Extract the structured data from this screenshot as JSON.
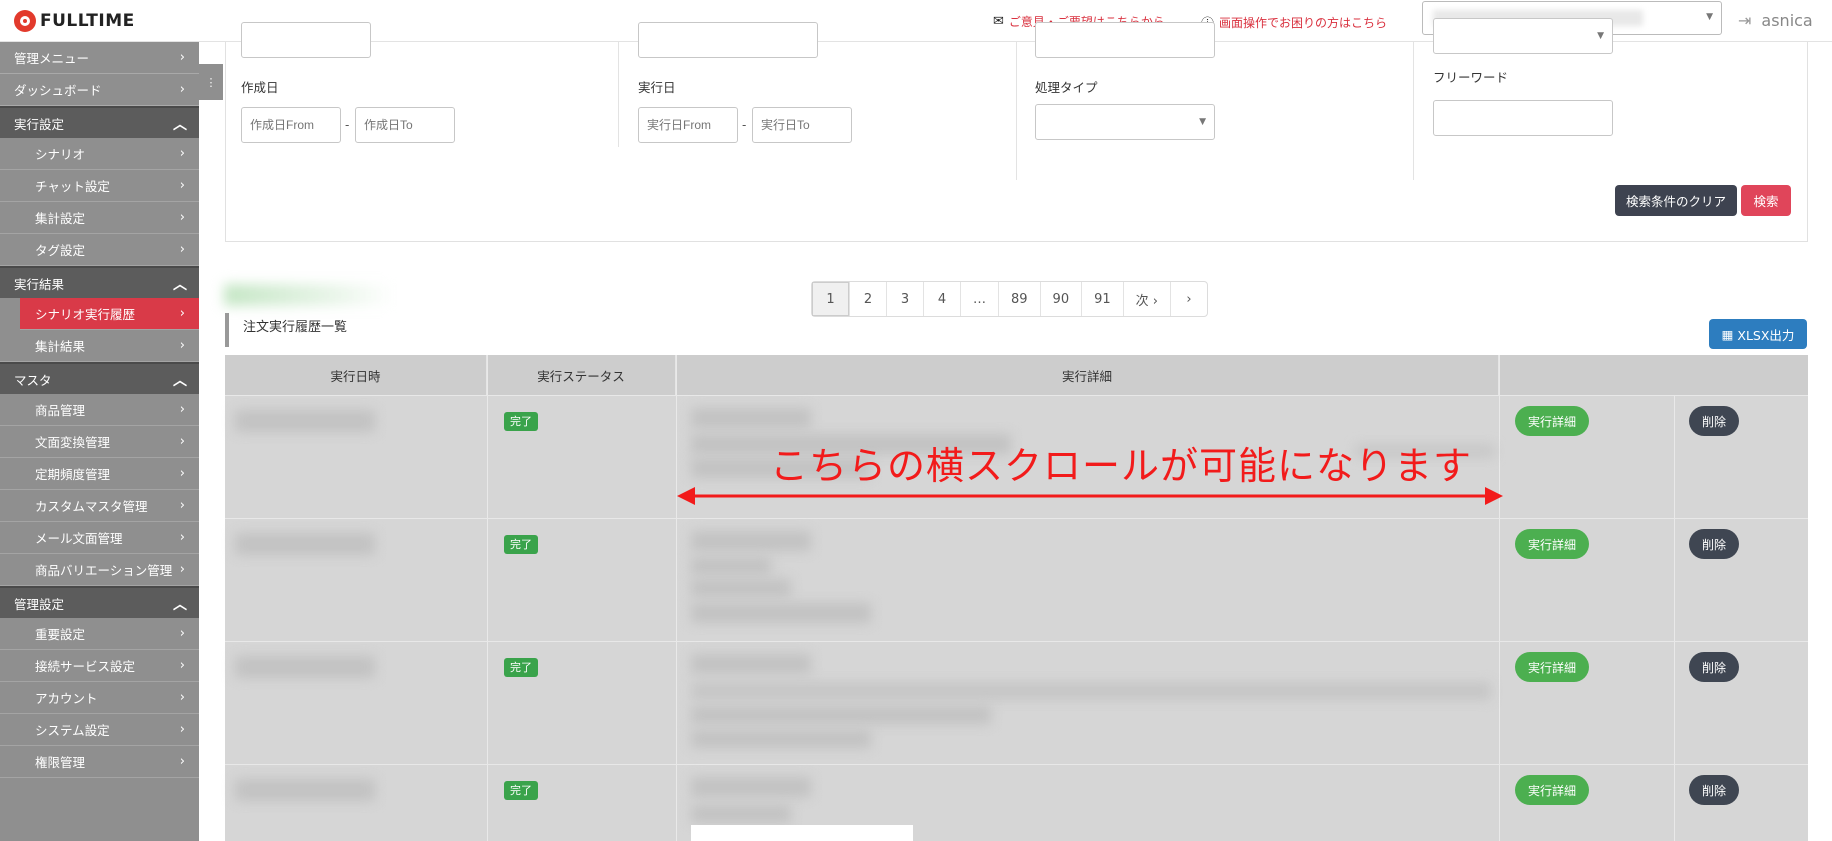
{
  "header": {
    "logo": "FULLTIME",
    "feedback_link": "ご意見・ご要望はこちらから",
    "help_link": "画面操作でお困りの方はこちら",
    "user": "asnica"
  },
  "sidebar": {
    "top_items": [
      {
        "label": "管理メニュー"
      },
      {
        "label": "ダッシュボード"
      }
    ],
    "sections": [
      {
        "title": "実行設定",
        "items": [
          "シナリオ",
          "チャット設定",
          "集計設定",
          "タグ設定"
        ]
      },
      {
        "title": "実行結果",
        "items": [
          "シナリオ実行履歴",
          "集計結果"
        ]
      },
      {
        "title": "マスタ",
        "items": [
          "商品管理",
          "文面変換管理",
          "定期頻度管理",
          "カスタムマスタ管理",
          "メール文面管理",
          "商品バリエーション管理"
        ]
      },
      {
        "title": "管理設定",
        "items": [
          "重要設定",
          "接続サービス設定",
          "アカウント",
          "システム設定",
          "権限管理"
        ]
      }
    ],
    "active_item": "シナリオ実行履歴"
  },
  "filters": {
    "created_label": "作成日",
    "created_from_placeholder": "作成日From",
    "created_to_placeholder": "作成日To",
    "executed_label": "実行日",
    "executed_from_placeholder": "実行日From",
    "executed_to_placeholder": "実行日To",
    "process_type_label": "処理タイプ",
    "freeword_label": "フリーワード",
    "range_sep": "-",
    "clear_button": "検索条件のクリア",
    "search_button": "検索"
  },
  "pagination": {
    "pages": [
      "1",
      "2",
      "3",
      "4",
      "…",
      "89",
      "90",
      "91",
      "次 ›"
    ],
    "current": "1",
    "next_icon": "›"
  },
  "list": {
    "title": "注文実行履歴一覧",
    "export_button": "XLSX出力",
    "columns": [
      "実行日時",
      "実行ステータス",
      "実行詳細"
    ],
    "rows": [
      {
        "status": "完了",
        "detail_button": "実行詳細",
        "delete_button": "削除"
      },
      {
        "status": "完了",
        "detail_button": "実行詳細",
        "delete_button": "削除"
      },
      {
        "status": "完了",
        "detail_button": "実行詳細",
        "delete_button": "削除"
      },
      {
        "status": "完了",
        "detail_button": "実行詳細",
        "delete_button": "削除"
      }
    ]
  },
  "annotation": {
    "text": "こちらの横スクロールが可能になります",
    "color": "#f21b1b"
  },
  "colors": {
    "accent_red": "#d93a48",
    "sidebar_bg": "#8f8f8f",
    "success_green": "#4caf50",
    "export_blue": "#2d7dbf"
  }
}
